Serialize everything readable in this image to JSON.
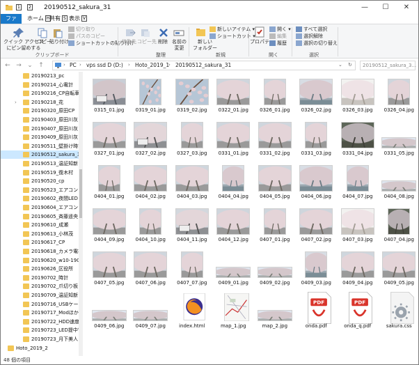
{
  "window": {
    "title": "20190512_sakura_31"
  },
  "quick_access": {
    "keytips": [
      "1",
      "2"
    ]
  },
  "tabs": [
    {
      "label": "ファイル",
      "keytip": "F"
    },
    {
      "label": "ホーム",
      "keytip": "H"
    },
    {
      "label": "共有",
      "keytip": "S"
    },
    {
      "label": "表示",
      "keytip": "V"
    }
  ],
  "ribbon": {
    "clipboard": {
      "quick_access": "クイック アクセス\nにピン留めする",
      "copy": "コピー",
      "paste": "貼り付け",
      "cut": "切り取り",
      "copy_path": "パスのコピー",
      "paste_shortcut": "ショートカットの貼り付け",
      "group": "クリップボード"
    },
    "organize": {
      "move_to": "移動先",
      "copy_to": "コピー先",
      "delete": "削除",
      "rename": "名前の\n変更",
      "group": "整理"
    },
    "new": {
      "new_folder": "新しい\nフォルダー",
      "new_item": "新しいアイテム",
      "shortcut": "ショートカット",
      "group": "新規"
    },
    "open": {
      "properties": "プロパティ",
      "open": "開く",
      "edit": "編集",
      "history": "履歴",
      "group": "開く"
    },
    "select": {
      "select_all": "すべて選択",
      "select_none": "選択解除",
      "invert": "選択の切り替え",
      "group": "選択"
    }
  },
  "address": {
    "crumbs": [
      "PC",
      "vps ssd D (D:)",
      "Hoto_2019_1",
      "20190512_sakura_31"
    ],
    "search_placeholder": "20190512_sakura_3..."
  },
  "nav": {
    "items": [
      {
        "label": "20190213_pc",
        "chevron": false
      },
      {
        "label": "20190214_心電計",
        "chevron": false
      },
      {
        "label": "20190216_CP自転車",
        "chevron": false
      },
      {
        "label": "20190218_花",
        "chevron": true
      },
      {
        "label": "20190320_原田CP",
        "chevron": false
      },
      {
        "label": "20190403_原田川灰",
        "chevron": false
      },
      {
        "label": "20190407_原田川灰",
        "chevron": false
      },
      {
        "label": "20190409_原田川灰",
        "chevron": false
      },
      {
        "label": "20190511_壁掛け時計",
        "chevron": false
      },
      {
        "label": "20190512_sakura_31",
        "chevron": false,
        "selected": true
      },
      {
        "label": "20190513_温証知新",
        "chevron": false
      },
      {
        "label": "20190519_復木村",
        "chevron": false
      },
      {
        "label": "20190520_cp",
        "chevron": false
      },
      {
        "label": "20190523_エアコン",
        "chevron": false
      },
      {
        "label": "20190602_夜間LED",
        "chevron": false
      },
      {
        "label": "20190604_エアコン",
        "chevron": false
      },
      {
        "label": "20190605_斉藤遥央",
        "chevron": false
      },
      {
        "label": "20190610_成瀬",
        "chevron": false
      },
      {
        "label": "20190613_小林茂",
        "chevron": false
      },
      {
        "label": "20190617_CP",
        "chevron": false
      },
      {
        "label": "20190618_カメラ電柱",
        "chevron": false
      },
      {
        "label": "20190620_w10-1903",
        "chevron": false
      },
      {
        "label": "20190626_区役所",
        "chevron": false
      },
      {
        "label": "20190702_時計",
        "chevron": false
      },
      {
        "label": "20190702_爪切り板４",
        "chevron": false
      },
      {
        "label": "20190709_温証知新",
        "chevron": false
      },
      {
        "label": "20190716_USBケーブル",
        "chevron": false
      },
      {
        "label": "20190717_Modほか",
        "chevron": false
      },
      {
        "label": "20190722_HDD速度",
        "chevron": false
      },
      {
        "label": "20190723_LED提中電灯",
        "chevron": false
      },
      {
        "label": "20190723_月下美人",
        "chevron": false
      },
      {
        "label": "Hoto_2019_2",
        "chevron": true,
        "level": 1
      }
    ]
  },
  "files": [
    {
      "name": "0315_01.jpg",
      "kind": "photo",
      "scene": "railing"
    },
    {
      "name": "0319_01.jpg",
      "kind": "photo",
      "scene": "blossom"
    },
    {
      "name": "0319_02.jpg",
      "kind": "photo",
      "scene": "blossom"
    },
    {
      "name": "0322_01.jpg",
      "kind": "photo",
      "scene": "tree"
    },
    {
      "name": "0326_01.jpg",
      "kind": "photo",
      "scene": "tree"
    },
    {
      "name": "0326_02.jpg",
      "kind": "photo",
      "scene": "river"
    },
    {
      "name": "0326_03.jpg",
      "kind": "photo",
      "scene": "bright"
    },
    {
      "name": "0326_04.jpg",
      "kind": "photo",
      "scene": "tree"
    },
    {
      "name": "0327_01.jpg",
      "kind": "photo",
      "scene": "tree"
    },
    {
      "name": "0327_02.jpg",
      "kind": "photo",
      "scene": "sign"
    },
    {
      "name": "0327_03.jpg",
      "kind": "photo",
      "scene": "tree"
    },
    {
      "name": "0331_01.jpg",
      "kind": "photo",
      "scene": "tree"
    },
    {
      "name": "0331_02.jpg",
      "kind": "photo",
      "scene": "tree"
    },
    {
      "name": "0331_03.jpg",
      "kind": "photo",
      "scene": "tree"
    },
    {
      "name": "0331_04.jpg",
      "kind": "photo",
      "scene": "dark"
    },
    {
      "name": "0331_05.jpg",
      "kind": "photo",
      "scene": "wide"
    },
    {
      "name": "0404_01.jpg",
      "kind": "photo",
      "scene": "tree"
    },
    {
      "name": "0404_02.jpg",
      "kind": "photo",
      "scene": "tree"
    },
    {
      "name": "0404_03.jpg",
      "kind": "photo",
      "scene": "tree"
    },
    {
      "name": "0404_04.jpg",
      "kind": "photo",
      "scene": "river"
    },
    {
      "name": "0404_05.jpg",
      "kind": "photo",
      "scene": "tree"
    },
    {
      "name": "0404_06.jpg",
      "kind": "photo",
      "scene": "river"
    },
    {
      "name": "0404_07.jpg",
      "kind": "photo",
      "scene": "river"
    },
    {
      "name": "0404_08.jpg",
      "kind": "photo",
      "scene": "wide"
    },
    {
      "name": "0404_09.jpg",
      "kind": "photo",
      "scene": "tree"
    },
    {
      "name": "0404_10.jpg",
      "kind": "photo",
      "scene": "tree"
    },
    {
      "name": "0404_11.jpg",
      "kind": "photo",
      "scene": "sign"
    },
    {
      "name": "0404_12.jpg",
      "kind": "photo",
      "scene": "tree"
    },
    {
      "name": "0407_01.jpg",
      "kind": "photo",
      "scene": "tree"
    },
    {
      "name": "0407_02.jpg",
      "kind": "photo",
      "scene": "tree"
    },
    {
      "name": "0407_03.jpg",
      "kind": "photo",
      "scene": "bright"
    },
    {
      "name": "0407_04.jpg",
      "kind": "photo",
      "scene": "dark"
    },
    {
      "name": "0407_05.jpg",
      "kind": "photo",
      "scene": "tree"
    },
    {
      "name": "0407_06.jpg",
      "kind": "photo",
      "scene": "tree"
    },
    {
      "name": "0407_07.jpg",
      "kind": "photo",
      "scene": "tree"
    },
    {
      "name": "0409_01.jpg",
      "kind": "photo",
      "scene": "wide"
    },
    {
      "name": "0409_02.jpg",
      "kind": "photo",
      "scene": "wide"
    },
    {
      "name": "0409_03.jpg",
      "kind": "photo",
      "scene": "river"
    },
    {
      "name": "0409_04.jpg",
      "kind": "photo",
      "scene": "tree"
    },
    {
      "name": "0409_05.jpg",
      "kind": "photo",
      "scene": "tree"
    },
    {
      "name": "0409_06.jpg",
      "kind": "photo",
      "scene": "wide"
    },
    {
      "name": "0409_07.jpg",
      "kind": "photo",
      "scene": "wide"
    },
    {
      "name": "index.html",
      "kind": "firefox"
    },
    {
      "name": "map_1.jpg",
      "kind": "map"
    },
    {
      "name": "map_2.jpg",
      "kind": "photo",
      "scene": "wide"
    },
    {
      "name": "onda.pdf",
      "kind": "pdf"
    },
    {
      "name": "onda_q.pdf",
      "kind": "pdf"
    },
    {
      "name": "sakura.css",
      "kind": "css"
    }
  ],
  "status": {
    "count_text": "48 個の項目"
  },
  "colors": {
    "accent": "#1979ca",
    "folder": "#f2c655",
    "selection": "#cce8ff",
    "blossom": "#e8d7dc",
    "pdf_red": "#d9342b"
  }
}
